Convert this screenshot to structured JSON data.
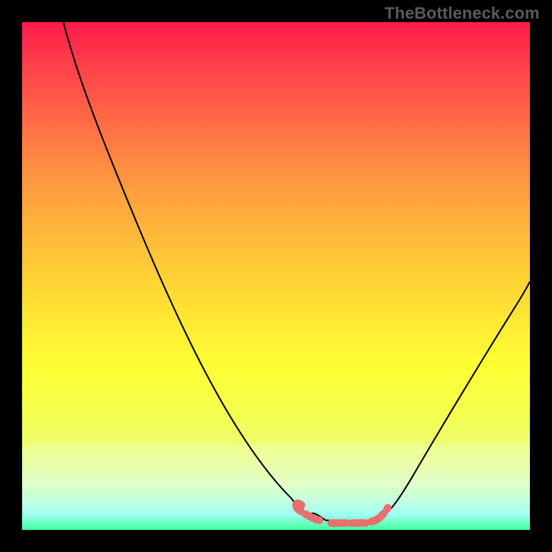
{
  "watermark": "TheBottleneck.com",
  "chart_data": {
    "type": "line",
    "title": "",
    "xlabel": "",
    "ylabel": "",
    "xlim": [
      0,
      100
    ],
    "ylim": [
      0,
      100
    ],
    "series": [
      {
        "name": "bottleneck-curve",
        "x": [
          0,
          8,
          16,
          24,
          32,
          40,
          48,
          56,
          60,
          62,
          64,
          66,
          68,
          70,
          74,
          80,
          88,
          96,
          100
        ],
        "values": [
          100,
          88,
          75,
          62,
          49,
          36,
          23,
          10,
          4,
          2,
          1,
          1,
          1,
          2,
          5,
          12,
          26,
          42,
          50
        ]
      }
    ],
    "highlight_band": {
      "y_from": 0,
      "y_to": 9
    },
    "marker_segment_x": [
      56,
      72
    ],
    "marker_color": "#e86f6f",
    "curve_color": "#000000",
    "background_gradient": [
      "#ff1a4a",
      "#40ff9c"
    ]
  }
}
